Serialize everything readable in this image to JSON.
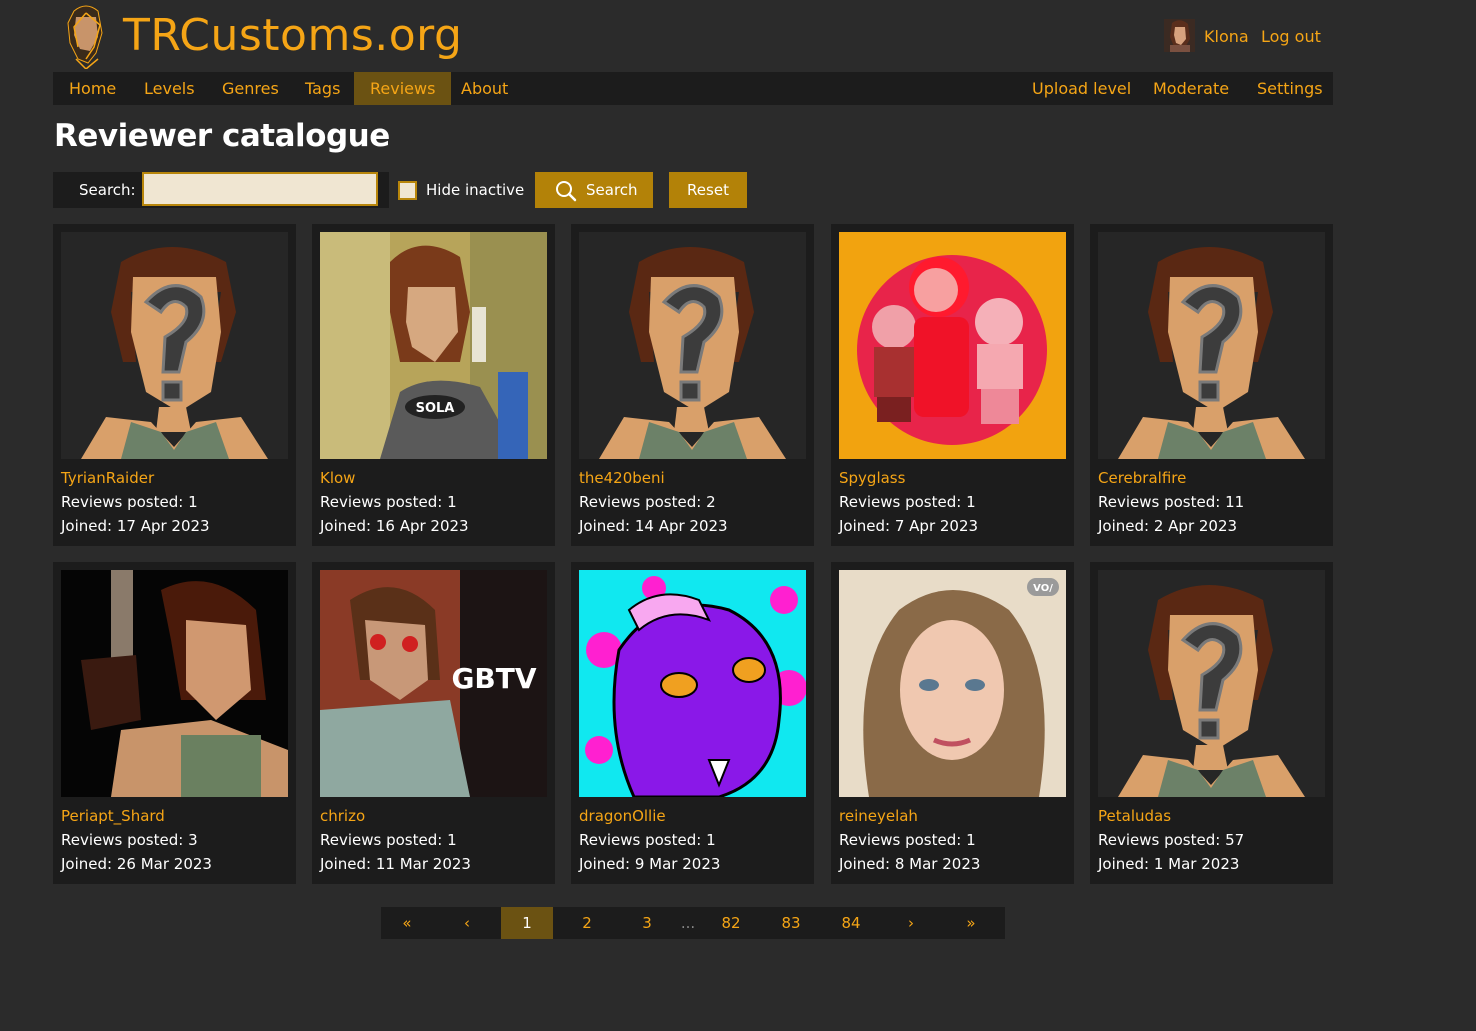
{
  "header": {
    "site_title": "TRCustoms.org",
    "username": "Klona",
    "logout_label": "Log out"
  },
  "nav": {
    "left": [
      "Home",
      "Levels",
      "Genres",
      "Tags",
      "Reviews",
      "About"
    ],
    "right": [
      "Upload level",
      "Moderate",
      "Settings"
    ],
    "active": "Reviews"
  },
  "page": {
    "title": "Reviewer catalogue"
  },
  "search": {
    "label": "Search:",
    "value": "",
    "hide_inactive_label": "Hide inactive",
    "hide_inactive_checked": false,
    "search_button": "Search",
    "reset_button": "Reset"
  },
  "reviewers": [
    {
      "name": "TyrianRaider",
      "reviews": "Reviews posted: 1",
      "joined": "Joined: 17 Apr 2023",
      "avatar": "default-avatar"
    },
    {
      "name": "Klow",
      "reviews": "Reviews posted: 1",
      "joined": "Joined: 16 Apr 2023",
      "avatar": "lara-wetsuit"
    },
    {
      "name": "the420beni",
      "reviews": "Reviews posted: 2",
      "joined": "Joined: 14 Apr 2023",
      "avatar": "default-avatar"
    },
    {
      "name": "Spyglass",
      "reviews": "Reviews posted: 1",
      "joined": "Joined: 7 Apr 2023",
      "avatar": "cartoon-kids"
    },
    {
      "name": "Cerebralfire",
      "reviews": "Reviews posted: 11",
      "joined": "Joined: 2 Apr 2023",
      "avatar": "default-avatar"
    },
    {
      "name": "Periapt_Shard",
      "reviews": "Reviews posted: 3",
      "joined": "Joined: 26 Mar 2023",
      "avatar": "lara-pistol"
    },
    {
      "name": "chrizo",
      "reviews": "Reviews posted: 1",
      "joined": "Joined: 11 Mar 2023",
      "avatar": "lara-gbtv"
    },
    {
      "name": "dragonOllie",
      "reviews": "Reviews posted: 1",
      "joined": "Joined: 9 Mar 2023",
      "avatar": "purple-dragon"
    },
    {
      "name": "reineyelah",
      "reviews": "Reviews posted: 1",
      "joined": "Joined: 8 Mar 2023",
      "avatar": "woman-portrait"
    },
    {
      "name": "Petaludas",
      "reviews": "Reviews posted: 57",
      "joined": "Joined: 1 Mar 2023",
      "avatar": "default-avatar"
    }
  ],
  "avatar_texts": {
    "lara_wetsuit_logo": "SOLA",
    "gbtv_logo": "GBTV",
    "portrait_badge": "VO/"
  },
  "pagination": {
    "first": "«",
    "prev": "‹",
    "pages": [
      "1",
      "2",
      "3"
    ],
    "ellipsis": "...",
    "last_pages": [
      "82",
      "83",
      "84"
    ],
    "next": "›",
    "last": "»",
    "current": "1"
  },
  "colors": {
    "accent": "#f5a516",
    "active_nav": "#6b5212",
    "button": "#b38208",
    "background": "#2b2b2b",
    "panel": "#1c1c1c"
  }
}
